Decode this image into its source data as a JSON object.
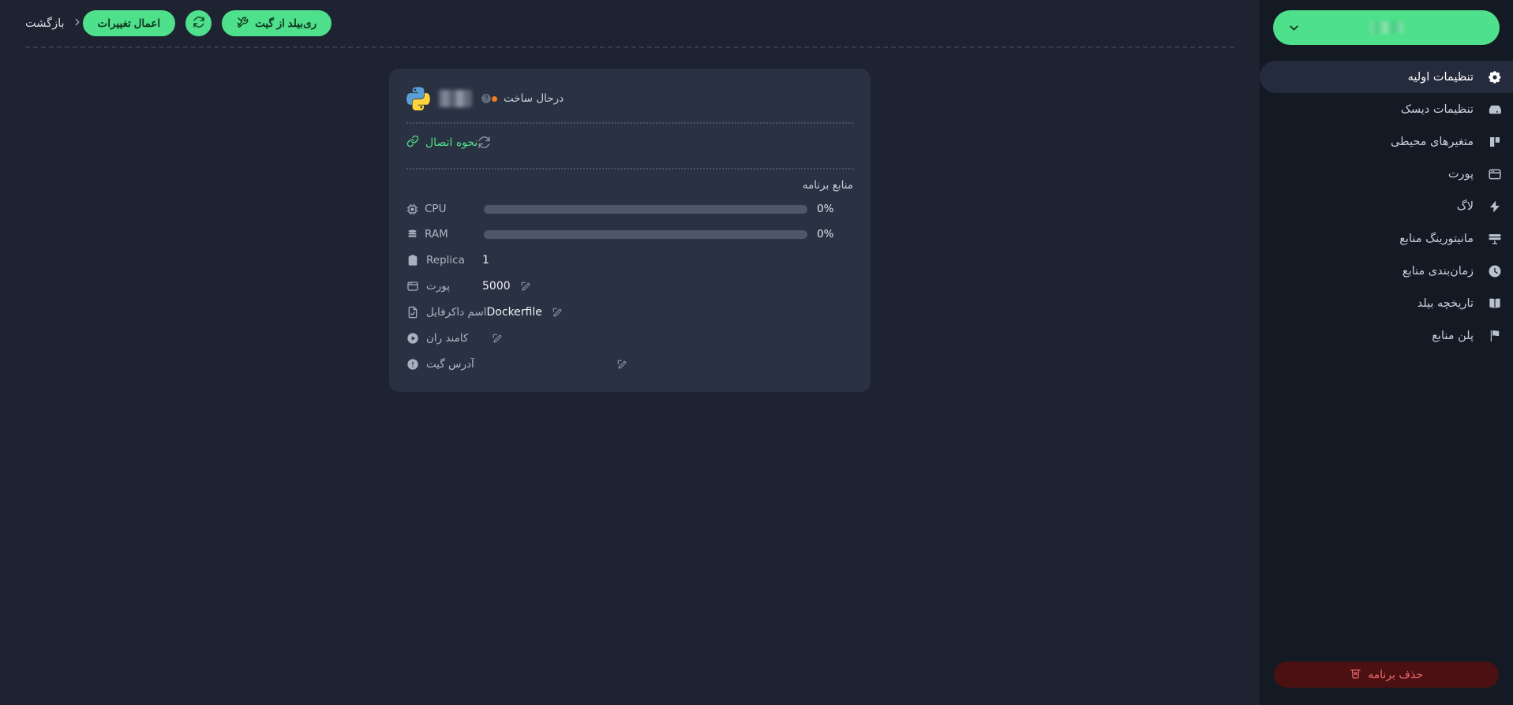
{
  "sidebar": {
    "brand": {
      "label_redacted": true,
      "chevron_icon": "chevron-down-icon"
    },
    "items": [
      {
        "label": "تنظیمات اولیه",
        "icon": "gear-icon",
        "active": true
      },
      {
        "label": "تنظیمات دیسک",
        "icon": "hard-drive-icon",
        "active": false
      },
      {
        "label": "متغیرهای محیطی",
        "icon": "env-vars-icon",
        "active": false
      },
      {
        "label": "پورت",
        "icon": "browser-icon",
        "active": false
      },
      {
        "label": "لاگ",
        "icon": "lightning-icon",
        "active": false
      },
      {
        "label": "مانیتورینگ منابع",
        "icon": "monitor-icon",
        "active": false
      },
      {
        "label": "زمان‌بندی منابع",
        "icon": "clock-icon",
        "active": false
      },
      {
        "label": "تاریخچه بیلد",
        "icon": "book-icon",
        "active": false
      },
      {
        "label": "پلن منابع",
        "icon": "flag-icon",
        "active": false
      }
    ],
    "delete_button": {
      "label": "حذف برنامه",
      "icon": "trash-icon"
    }
  },
  "topbar": {
    "back": {
      "label": "بازگشت",
      "icon": "chevron-right-icon"
    },
    "apply_changes": {
      "label": "اعمال تغییرات"
    },
    "refresh": {
      "icon": "refresh-icon"
    },
    "rebuild_from_git": {
      "label": "ری‌بیلد از گیت",
      "icon": "tools-icon"
    }
  },
  "card": {
    "runtime_icon": "python-logo-icon",
    "app_name_redacted": true,
    "help_icon": "help-circle-icon",
    "status": {
      "label": "درحال ساخت",
      "dot_color": "#f07c22"
    },
    "connection": {
      "label": "نحوه اتصال",
      "icon": "link-icon",
      "refresh_icon": "refresh-icon"
    },
    "resources_title": "منابع برنامه",
    "resources": [
      {
        "label": "CPU",
        "icon": "cpu-icon",
        "value": "0%",
        "percent": 0
      },
      {
        "label": "RAM",
        "icon": "ram-icon",
        "value": "0%",
        "percent": 0
      }
    ],
    "details": [
      {
        "label": "Replica",
        "icon": "clipboard-icon",
        "value": "1",
        "editable": false,
        "redacted": false
      },
      {
        "label": "پورت",
        "icon": "browser-icon",
        "value": "5000",
        "editable": true,
        "redacted": false
      },
      {
        "label": "اسم داکرفایل",
        "icon": "file-check-icon",
        "value": "Dockerfile",
        "editable": true,
        "redacted": false
      },
      {
        "label": "کامند ران",
        "icon": "play-circle-icon",
        "value": "",
        "editable": true,
        "redacted": false
      },
      {
        "label": "آدرس گیت",
        "icon": "info-circle-icon",
        "value": "",
        "editable": true,
        "redacted": true
      }
    ]
  },
  "colors": {
    "page_bg": "#1e2332",
    "sidebar_bg": "#141a24",
    "card_bg": "#2a3142",
    "accent_green": "#4ee08a",
    "danger_red": "#f0696c",
    "status_orange": "#f07c22"
  }
}
